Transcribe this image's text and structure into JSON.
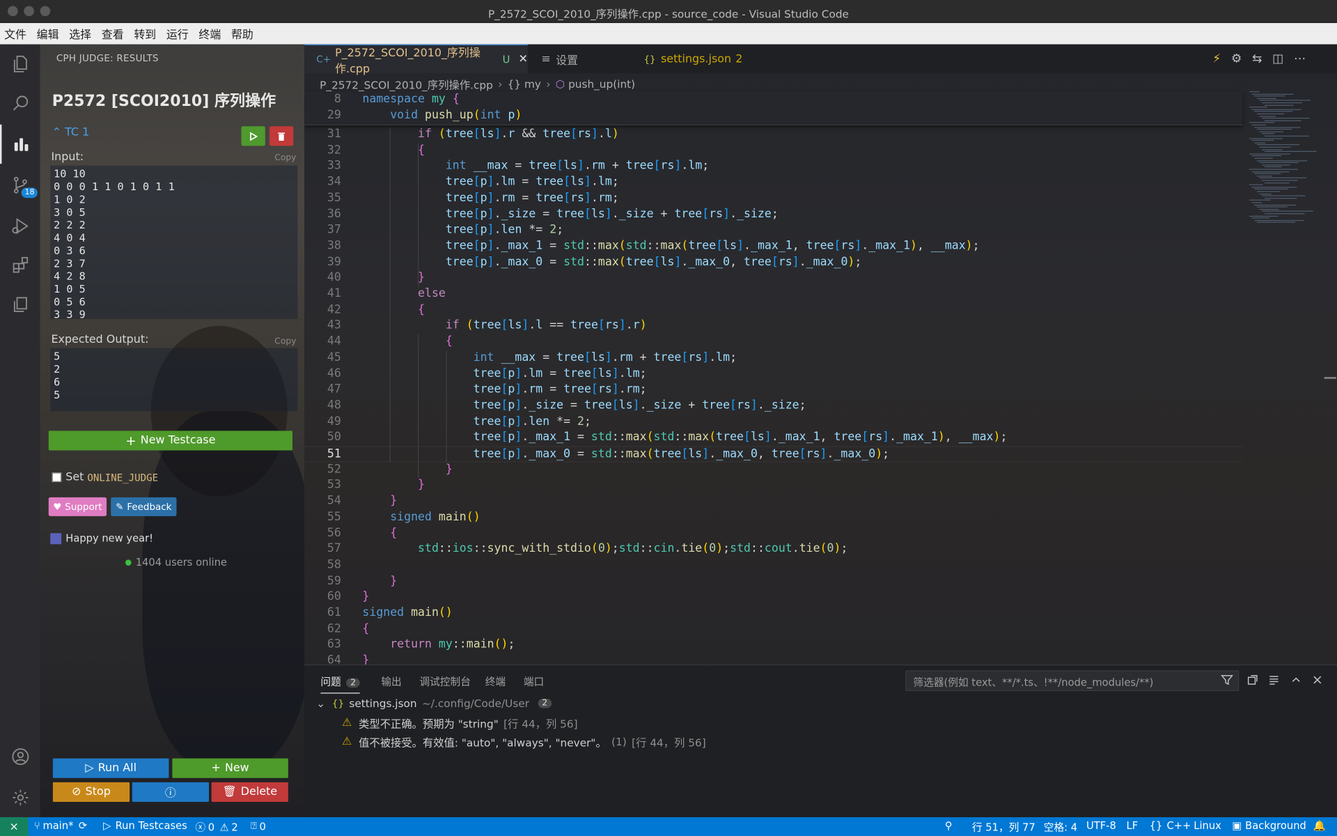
{
  "window": {
    "title": "P_2572_SCOI_2010_序列操作.cpp - source_code - Visual Studio Code"
  },
  "menu": [
    "文件",
    "编辑",
    "选择",
    "查看",
    "转到",
    "运行",
    "终端",
    "帮助"
  ],
  "activity": {
    "scm_badge": "18"
  },
  "sidebar": {
    "header": "CPH JUDGE: RESULTS",
    "problem_title": "P2572 [SCOI2010] 序列操作",
    "testcase_label": "TC 1",
    "input_label": "Input:",
    "copy_label": "Copy",
    "input_text": "10 10\n0 0 0 1 1 0 1 0 1 1\n1 0 2\n3 0 5\n2 2 2\n4 0 4\n0 3 6\n2 3 7\n4 2 8\n1 0 5\n0 5 6\n3 3 9",
    "expected_label": "Expected Output:",
    "expected_text": "5\n2\n6\n5",
    "new_testcase": "New Testcase",
    "set_label": "Set",
    "online_judge": "ONLINE_JUDGE",
    "support": "Support",
    "feedback": "Feedback",
    "happy": "Happy new year!",
    "online": "1404 users online",
    "run_all": "Run All",
    "new": "New",
    "stop": "Stop",
    "delete": "Delete"
  },
  "tabs": [
    {
      "label": "P_2572_SCOI_2010_序列操作.cpp",
      "status": "U"
    },
    {
      "label": "设置"
    },
    {
      "label": "settings.json",
      "count": "2"
    }
  ],
  "breadcrumb": [
    "P_2572_SCOI_2010_序列操作.cpp",
    "{} my",
    "push_up(int)"
  ],
  "code": {
    "sticky": [
      {
        "n": "8",
        "t": "namespace my {"
      },
      {
        "n": "29",
        "t": "    void push_up(int p)"
      }
    ],
    "lines": [
      {
        "n": "31",
        "t": "        if (tree[ls].r && tree[rs].l)"
      },
      {
        "n": "32",
        "t": "        {"
      },
      {
        "n": "33",
        "t": "            int __max = tree[ls].rm + tree[rs].lm;"
      },
      {
        "n": "34",
        "t": "            tree[p].lm = tree[ls].lm;"
      },
      {
        "n": "35",
        "t": "            tree[p].rm = tree[rs].rm;"
      },
      {
        "n": "36",
        "t": "            tree[p]._size = tree[ls]._size + tree[rs]._size;"
      },
      {
        "n": "37",
        "t": "            tree[p].len *= 2;"
      },
      {
        "n": "38",
        "t": "            tree[p]._max_1 = std::max(std::max(tree[ls]._max_1, tree[rs]._max_1), __max);"
      },
      {
        "n": "39",
        "t": "            tree[p]._max_0 = std::max(tree[ls]._max_0, tree[rs]._max_0);"
      },
      {
        "n": "40",
        "t": "        }"
      },
      {
        "n": "41",
        "t": "        else"
      },
      {
        "n": "42",
        "t": "        {"
      },
      {
        "n": "43",
        "t": "            if (tree[ls].l == tree[rs].r)"
      },
      {
        "n": "44",
        "t": "            {"
      },
      {
        "n": "45",
        "t": "                int __max = tree[ls].rm + tree[rs].lm;"
      },
      {
        "n": "46",
        "t": "                tree[p].lm = tree[ls].lm;"
      },
      {
        "n": "47",
        "t": "                tree[p].rm = tree[rs].rm;"
      },
      {
        "n": "48",
        "t": "                tree[p]._size = tree[ls]._size + tree[rs]._size;"
      },
      {
        "n": "49",
        "t": "                tree[p].len *= 2;"
      },
      {
        "n": "50",
        "t": "                tree[p]._max_1 = std::max(std::max(tree[ls]._max_1, tree[rs]._max_1), __max);"
      },
      {
        "n": "51",
        "t": "                tree[p]._max_0 = std::max(tree[ls]._max_0, tree[rs]._max_0);"
      },
      {
        "n": "52",
        "t": "            }"
      },
      {
        "n": "53",
        "t": "        }"
      },
      {
        "n": "54",
        "t": "    }"
      },
      {
        "n": "55",
        "t": "    signed main()"
      },
      {
        "n": "56",
        "t": "    {"
      },
      {
        "n": "57",
        "t": "        std::ios::sync_with_stdio(0);std::cin.tie(0);std::cout.tie(0);"
      },
      {
        "n": "58",
        "t": ""
      },
      {
        "n": "59",
        "t": "    }"
      },
      {
        "n": "60",
        "t": "}"
      },
      {
        "n": "61",
        "t": "signed main()"
      },
      {
        "n": "62",
        "t": "{"
      },
      {
        "n": "63",
        "t": "    return my::main();"
      },
      {
        "n": "64",
        "t": "}"
      }
    ],
    "current_line": "51"
  },
  "panel": {
    "tabs": [
      "问题",
      "输出",
      "调试控制台",
      "终端",
      "端口"
    ],
    "problems_count": "2",
    "filter_placeholder": "筛选器(例如 text、**/*.ts、!**/node_modules/**)",
    "group_file": "settings.json",
    "group_path": "~/.config/Code/User",
    "group_count": "2",
    "problems": [
      {
        "msg": "类型不正确。预期为 \"string\"",
        "loc": "[行 44，列 56]"
      },
      {
        "msg": "值不被接受。有效值: \"auto\", \"always\", \"never\"。",
        "code": "(1)",
        "loc": "[行 44，列 56]"
      }
    ]
  },
  "status": {
    "branch": "main*",
    "run_testcases": "Run Testcases",
    "errors": "0",
    "warnings": "2",
    "ports": "0",
    "position": "行 51，列 77",
    "spaces": "空格: 4",
    "encoding": "UTF-8",
    "eol": "LF",
    "language": "C++",
    "platform": "Linux",
    "background": "Background"
  },
  "colors": {
    "accent": "#0078d4",
    "remote": "#16825d",
    "keyword": "#c586c0",
    "type": "#569cd6",
    "number": "#b5cea8",
    "variable": "#9cdcfe",
    "function": "#dcdcaa"
  }
}
